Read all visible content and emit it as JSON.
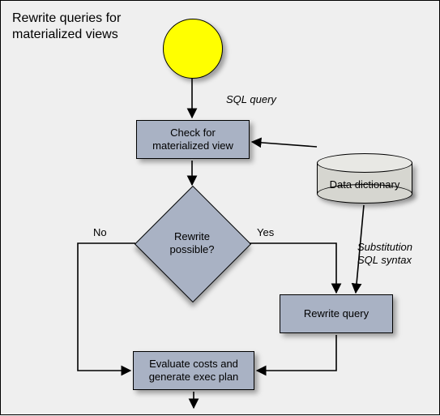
{
  "title": "Rewrite queries for\nmaterialized views",
  "nodes": {
    "start": "",
    "check": "Check for\nmaterialized view",
    "decision": "Rewrite\npossible?",
    "rewrite": "Rewrite query",
    "evaluate": "Evaluate costs and\ngenerate exec plan",
    "dict": "Data dictionary"
  },
  "edges": {
    "sql_query": "SQL query",
    "no": "No",
    "yes": "Yes",
    "substitution": "Substitution\nSQL syntax"
  },
  "colors": {
    "node_fill": "#a9b2c4",
    "start_fill": "#ffff00",
    "cyl_fill": "#d6d6d0",
    "bg": "#efefef"
  }
}
